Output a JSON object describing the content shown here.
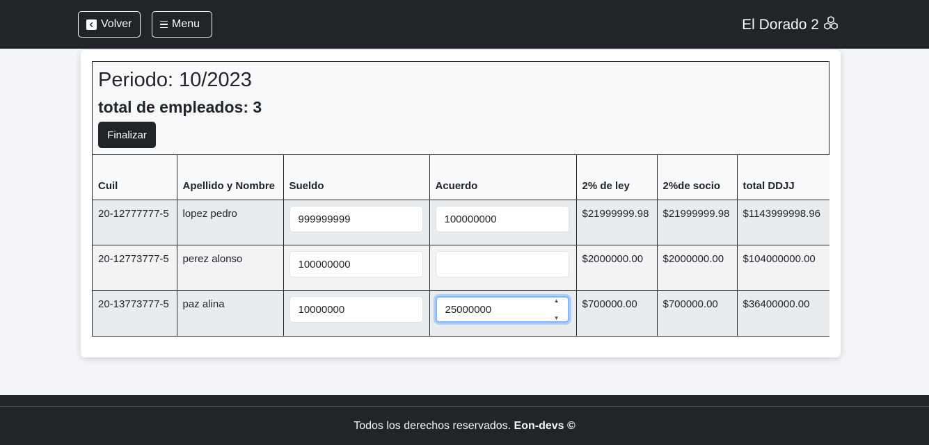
{
  "navbar": {
    "back_label": "Volver",
    "menu_label": "Menu",
    "brand": "El Dorado 2"
  },
  "main": {
    "periodo": "Periodo: 10/2023",
    "total_empleados": "total de empleados: 3",
    "finalize_label": "Finalizar"
  },
  "table": {
    "headers": [
      "Cuil",
      "Apellido y Nombre",
      "Sueldo",
      "Acuerdo",
      "2% de ley",
      "2%de socio",
      "total DDJJ"
    ],
    "rows": [
      {
        "cuil": "20-12777777-5",
        "nombre": "lopez pedro",
        "sueldo": "999999999",
        "acuerdo": "100000000",
        "ley": "$21999999.98",
        "socio": "$21999999.98",
        "total": "$1143999998.96"
      },
      {
        "cuil": "20-12773777-5",
        "nombre": "perez alonso",
        "sueldo": "100000000",
        "acuerdo": "",
        "ley": "$2000000.00",
        "socio": "$2000000.00",
        "total": "$104000000.00"
      },
      {
        "cuil": "20-13773777-5",
        "nombre": "paz alina",
        "sueldo": "10000000",
        "acuerdo": "25000000",
        "ley": "$700000.00",
        "socio": "$700000.00",
        "total": "$36400000.00"
      }
    ]
  },
  "footer": {
    "text": "Todos los derechos reservados.",
    "brand": "Eon-devs ©"
  }
}
